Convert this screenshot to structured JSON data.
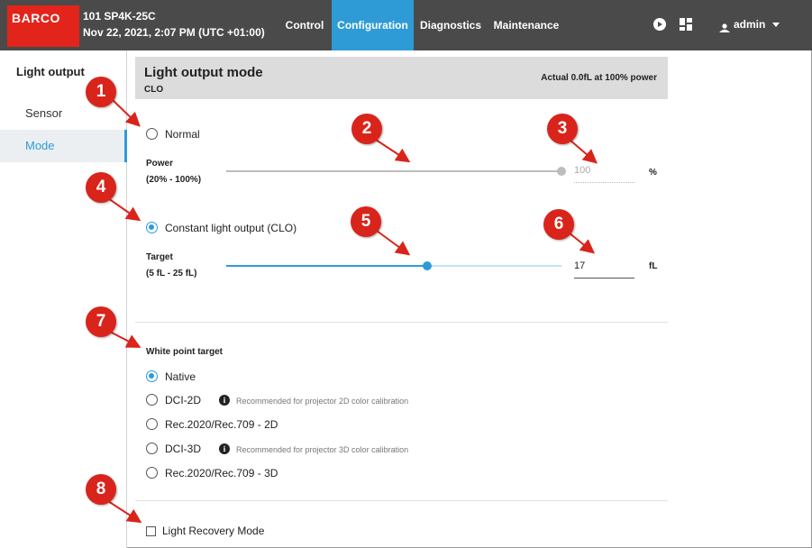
{
  "header": {
    "brand": "BARCO",
    "device": "101 SP4K-25C",
    "datetime": "Nov 22, 2021, 2:07 PM (UTC +01:00)",
    "nav": [
      "Control",
      "Configuration",
      "Diagnostics",
      "Maintenance"
    ],
    "active_nav": "Configuration",
    "user": "admin",
    "accent": "#2e9bd6"
  },
  "sidebar": {
    "title": "Light output",
    "items": [
      {
        "label": "Sensor",
        "active": false
      },
      {
        "label": "Mode",
        "active": true
      }
    ]
  },
  "panel": {
    "title": "Light output mode",
    "subtitle": "CLO",
    "actual": "Actual 0.0fL at 100% power"
  },
  "modes": {
    "normal_label": "Normal",
    "power_label": "Power",
    "power_range": "(20% - 100%)",
    "power_value": "100",
    "power_unit": "%",
    "power_slider_fraction": 1.0,
    "clo_label": "Constant light output (CLO)",
    "clo_selected": true,
    "target_label": "Target",
    "target_range": "(5 fL - 25 fL)",
    "target_value": "17",
    "target_unit": "fL",
    "target_slider_fraction": 0.6
  },
  "white_point": {
    "title": "White point target",
    "options": [
      {
        "label": "Native",
        "selected": true,
        "hint": ""
      },
      {
        "label": "DCI-2D",
        "selected": false,
        "hint": "Recommended for projector 2D color calibration"
      },
      {
        "label": "Rec.2020/Rec.709 - 2D",
        "selected": false,
        "hint": ""
      },
      {
        "label": "DCI-3D",
        "selected": false,
        "hint": "Recommended for projector 3D color calibration"
      },
      {
        "label": "Rec.2020/Rec.709 - 3D",
        "selected": false,
        "hint": ""
      }
    ]
  },
  "light_recovery": {
    "label": "Light Recovery Mode",
    "checked": false
  },
  "callouts": [
    "1",
    "2",
    "3",
    "4",
    "5",
    "6",
    "7",
    "8"
  ],
  "callout_color": "#d9241b"
}
